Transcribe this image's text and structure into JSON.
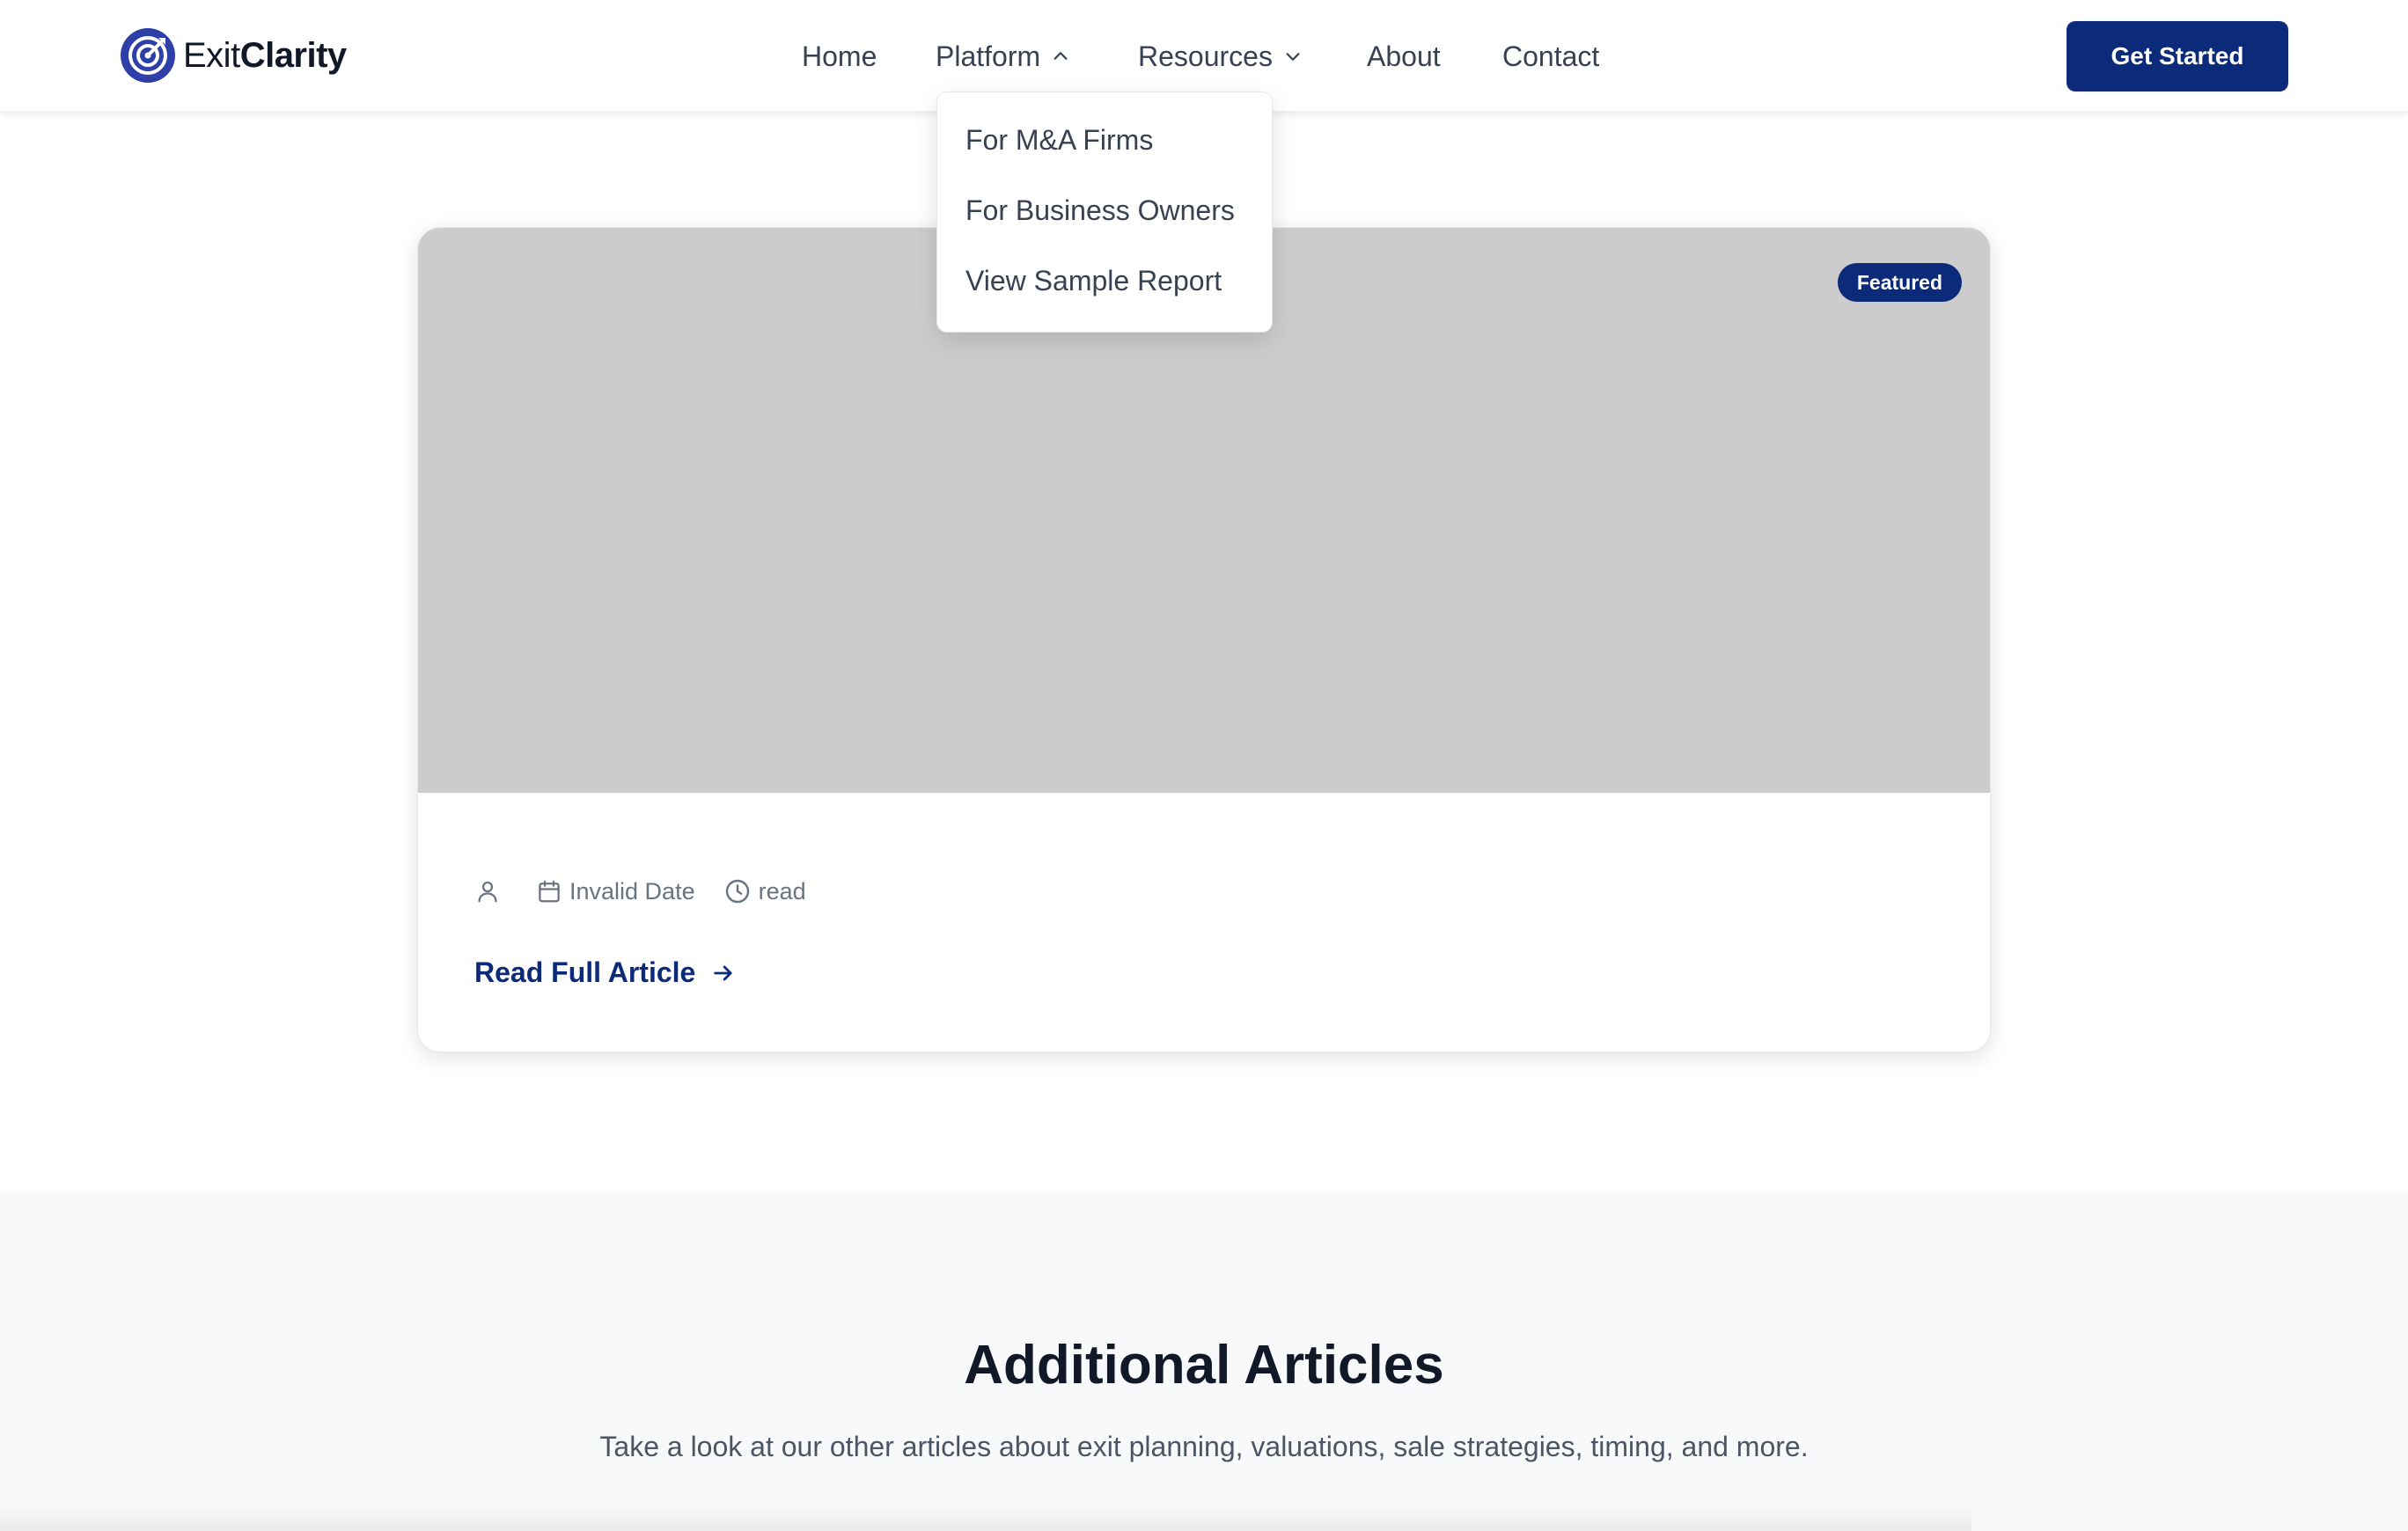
{
  "brand": {
    "name_regular": "Exit",
    "name_bold": "Clarity",
    "color": "#0b2a7a",
    "logo_icon": "target-logo-icon"
  },
  "nav": {
    "items": [
      {
        "label": "Home"
      },
      {
        "label": "Platform",
        "icon": "chevron-up-icon",
        "expanded": true
      },
      {
        "label": "Resources",
        "icon": "chevron-down-icon"
      },
      {
        "label": "About"
      },
      {
        "label": "Contact"
      }
    ],
    "cta_label": "Get Started"
  },
  "platform_dropdown": {
    "items": [
      {
        "label": "For M&A Firms"
      },
      {
        "label": "For Business Owners"
      },
      {
        "label": "View Sample Report"
      }
    ]
  },
  "featured": {
    "badge": "Featured",
    "image_placeholder_color": "#cccccc",
    "meta": {
      "author_icon": "user-icon",
      "date_icon": "calendar-icon",
      "date": "Invalid Date",
      "read_icon": "clock-icon",
      "read": "read"
    },
    "link_label": "Read Full Article",
    "link_icon": "arrow-right-icon"
  },
  "additional": {
    "title": "Additional Articles",
    "subtitle": "Take a look at our other articles about exit planning, valuations, sale strategies, timing, and more."
  }
}
